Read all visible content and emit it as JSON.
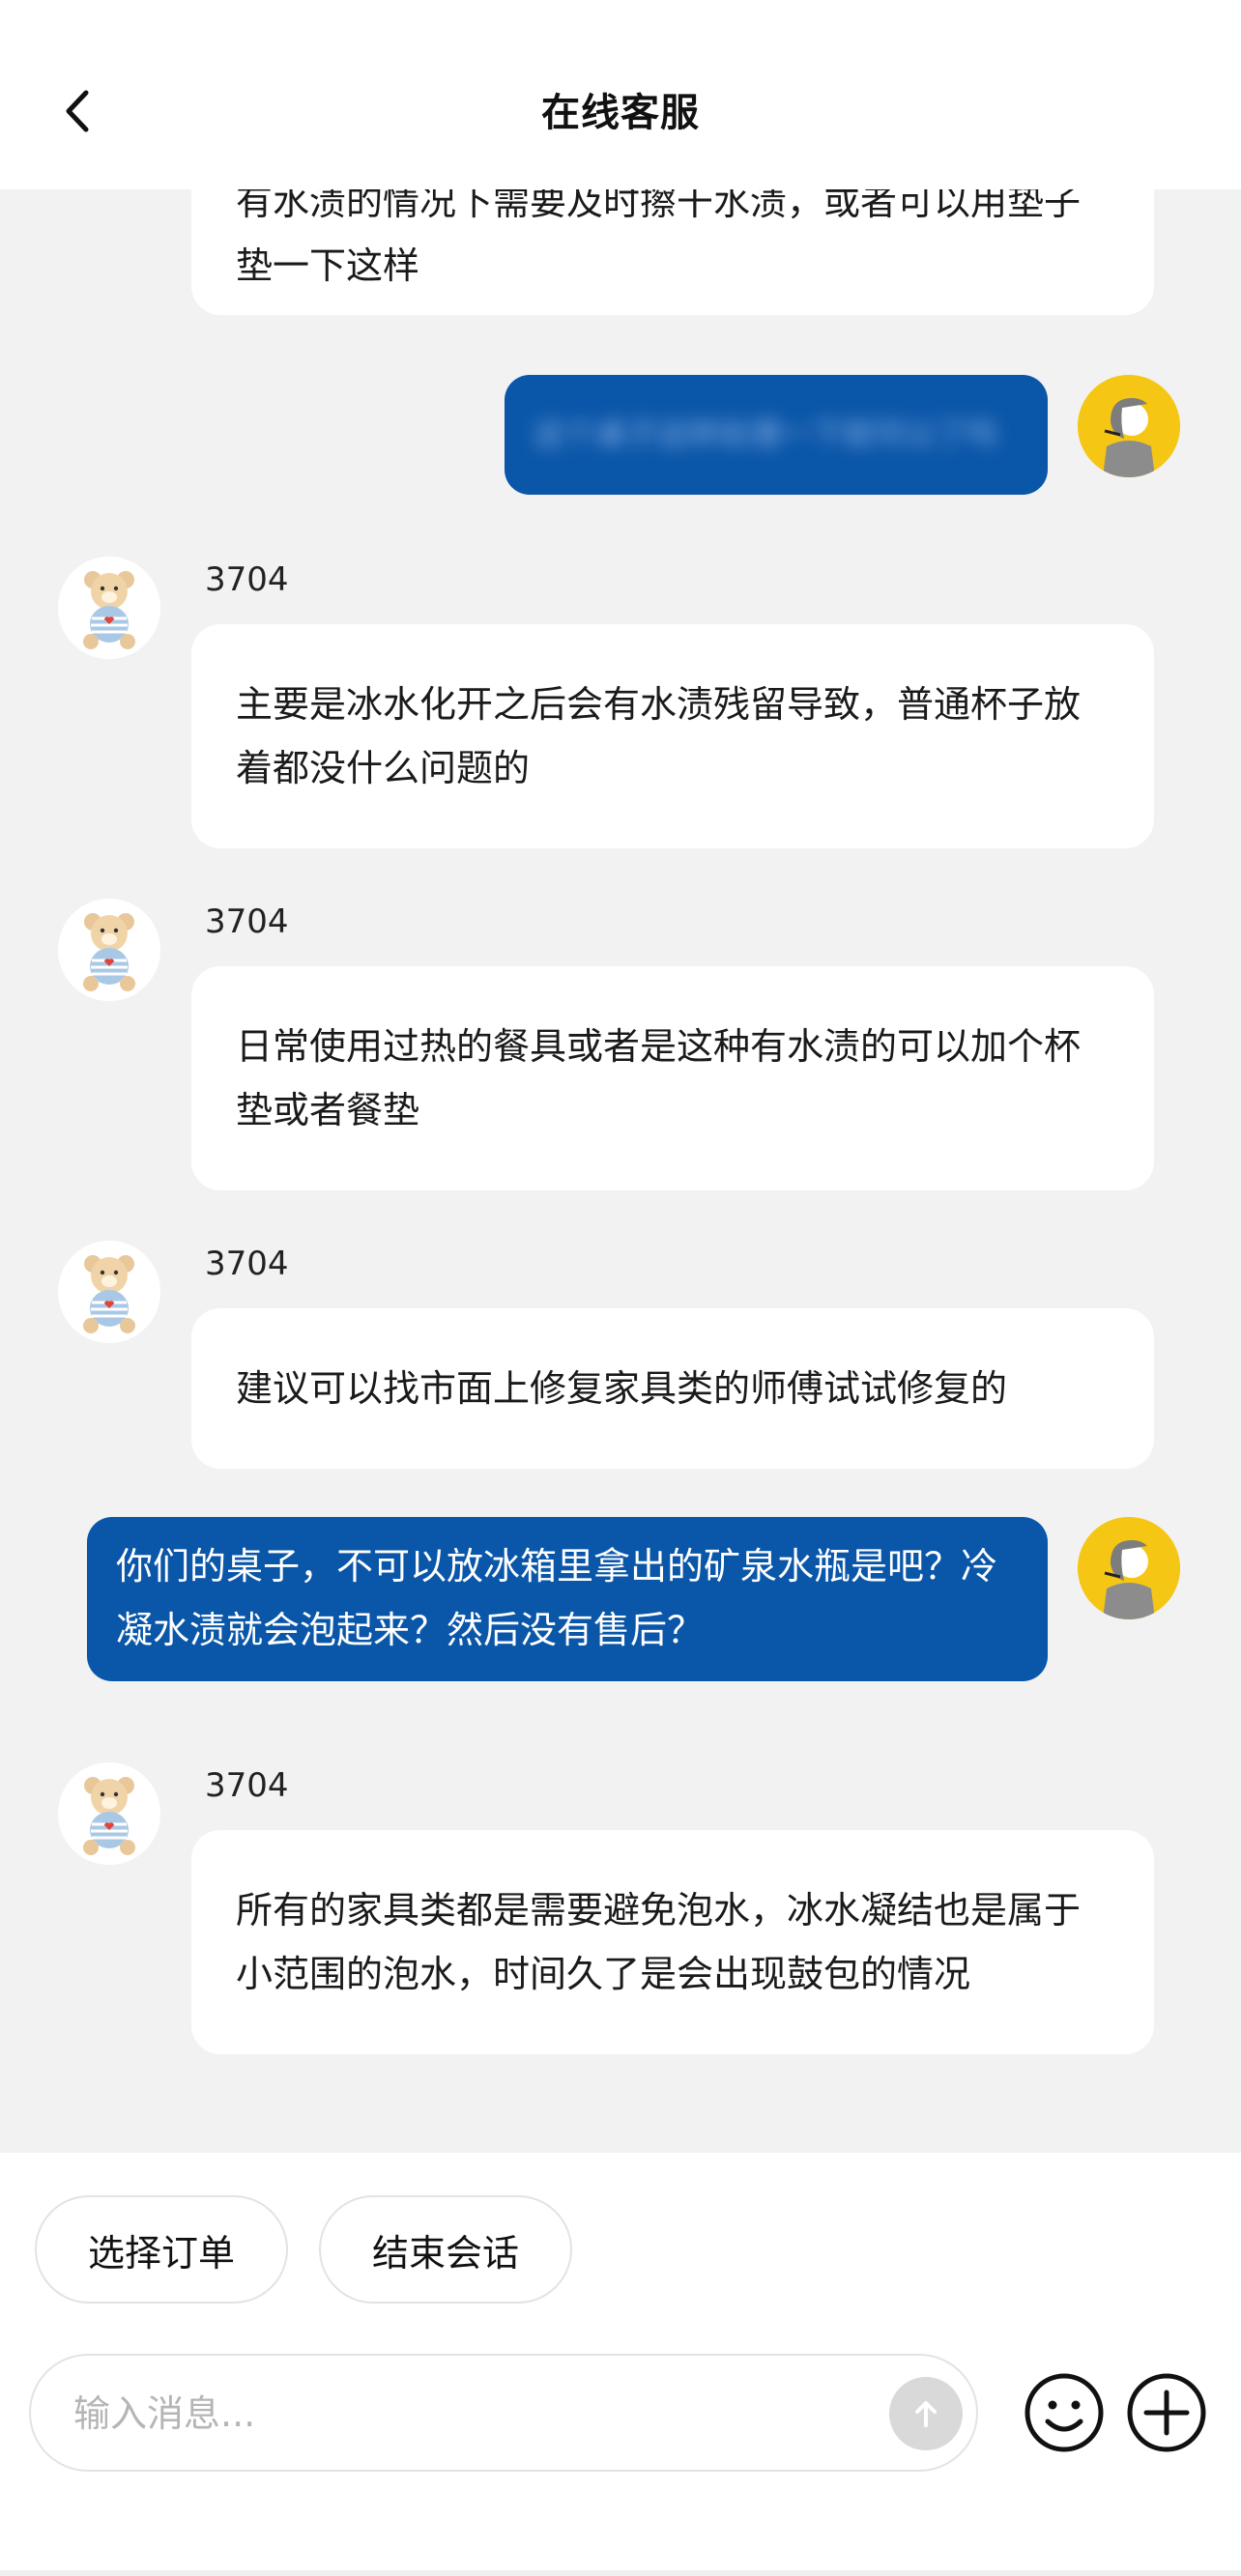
{
  "header": {
    "title": "在线客服",
    "back_icon": "chevron-left-icon"
  },
  "messages": [
    {
      "from": "agent",
      "name": "",
      "text": "有水渍的情况下需要及时擦干水渍，或者可以用垫子垫一下这样"
    },
    {
      "from": "user",
      "text": "这个桌子这样处理一下就可以了吗",
      "blurred": true
    },
    {
      "from": "agent",
      "name": "3704",
      "text": "主要是冰水化开之后会有水渍残留导致，普通杯子放着都没什么问题的"
    },
    {
      "from": "agent",
      "name": "3704",
      "text": "日常使用过热的餐具或者是这种有水渍的可以加个杯垫或者餐垫"
    },
    {
      "from": "agent",
      "name": "3704",
      "text": "建议可以找市面上修复家具类的师傅试试修复的"
    },
    {
      "from": "user",
      "text": "你们的桌子，不可以放冰箱里拿出的矿泉水瓶是吧？冷凝水渍就会泡起来？然后没有售后？"
    },
    {
      "from": "agent",
      "name": "3704",
      "text": "所有的家具类都是需要避免泡水，冰水凝结也是属于小范围的泡水，时间久了是会出现鼓包的情况"
    }
  ],
  "quick_actions": [
    {
      "label": "选择订单"
    },
    {
      "label": "结束会话"
    }
  ],
  "composer": {
    "placeholder": "输入消息...",
    "value": "",
    "send_icon": "arrow-up-icon",
    "emoji_icon": "smiley-icon",
    "plus_icon": "plus-circle-icon"
  },
  "colors": {
    "user_bubble": "#0a56a8",
    "user_avatar_bg": "#f5c613",
    "chat_bg": "#f2f2f2"
  }
}
